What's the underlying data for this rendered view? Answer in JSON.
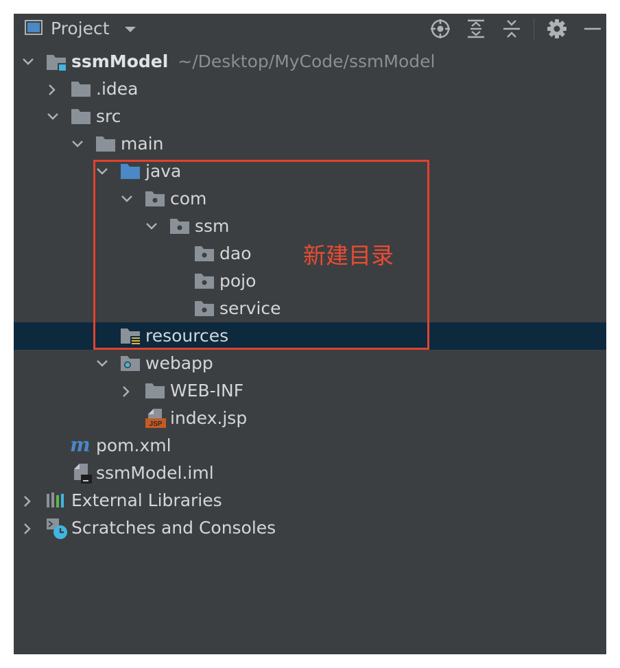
{
  "toolbar": {
    "view_title": "Project",
    "icons": [
      "view-icon",
      "dropdown-icon",
      "locate-icon",
      "expand-all-icon",
      "collapse-all-icon",
      "gear-icon",
      "minimize-icon"
    ]
  },
  "tree": {
    "root": {
      "name": "ssmModel",
      "path": "~/Desktop/MyCode/ssmModel"
    },
    "idea": ".idea",
    "src": "src",
    "main": "main",
    "java": "java",
    "com": "com",
    "ssm": "ssm",
    "dao": "dao",
    "pojo": "pojo",
    "service": "service",
    "resources": "resources",
    "webapp": "webapp",
    "webinf": "WEB-INF",
    "indexjsp": "index.jsp",
    "pomxml": "pom.xml",
    "iml": "ssmModel.iml",
    "libs": "External Libraries",
    "scratches": "Scratches and Consoles",
    "selected_item": "resources"
  },
  "annotation": {
    "text": "新建目录",
    "color": "#e0432d"
  },
  "colors": {
    "panel_bg": "#3c3f41",
    "selection_bg": "#0d293e",
    "folder": "#8a9199",
    "source_folder": "#4a88c7"
  }
}
